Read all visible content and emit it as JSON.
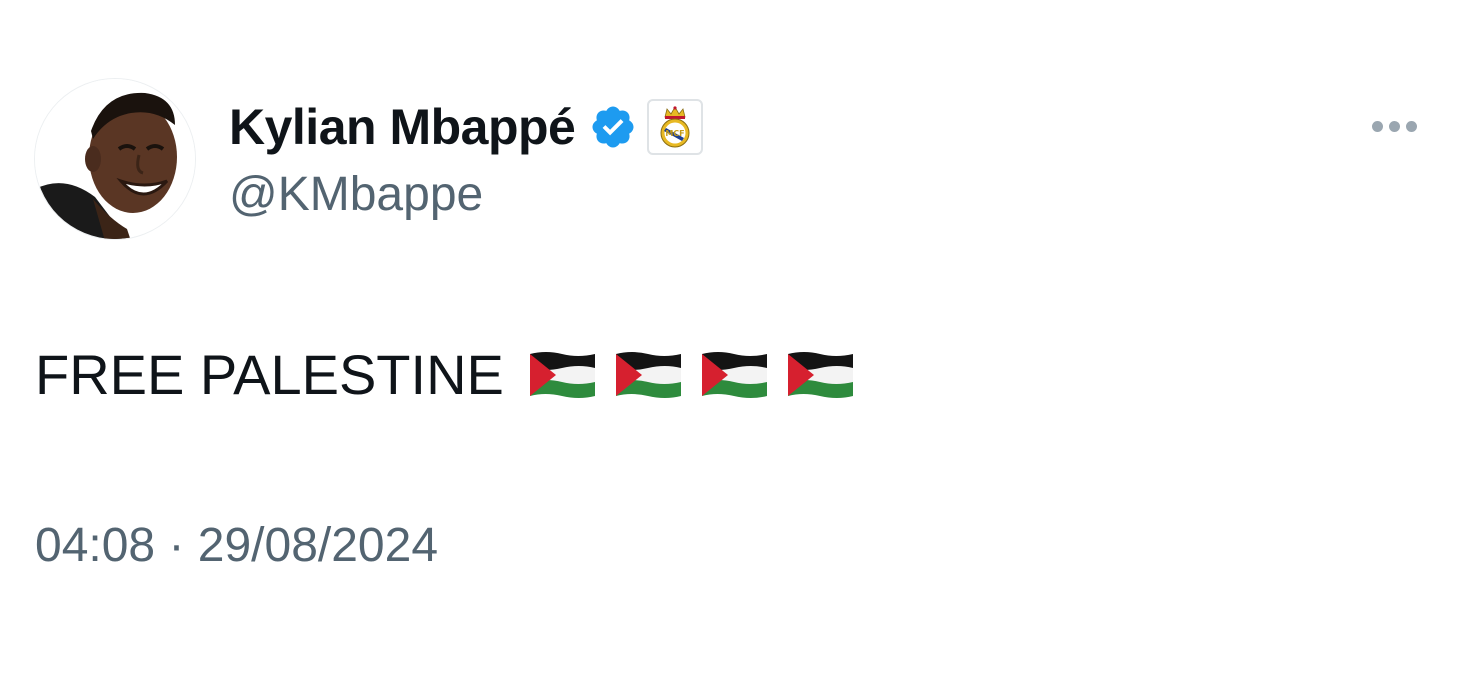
{
  "author": {
    "display_name": "Kylian Mbappé",
    "handle": "@KMbappe",
    "verified": true,
    "verified_color": "#1d9bf0",
    "affiliate_badge_icon": "real-madrid-crest-icon"
  },
  "tweet": {
    "text": "FREE PALESTINE",
    "emojis": [
      "palestine-flag-icon",
      "palestine-flag-icon",
      "palestine-flag-icon",
      "palestine-flag-icon"
    ],
    "timestamp": "04:08 · 29/08/2024"
  },
  "menu": {
    "icon": "more-icon"
  },
  "colors": {
    "text_primary": "#0f1419",
    "text_secondary": "#536471",
    "flag_black": "#141414",
    "flag_white": "#f3f3f3",
    "flag_green": "#2e8b3d",
    "flag_red": "#d6202f"
  }
}
